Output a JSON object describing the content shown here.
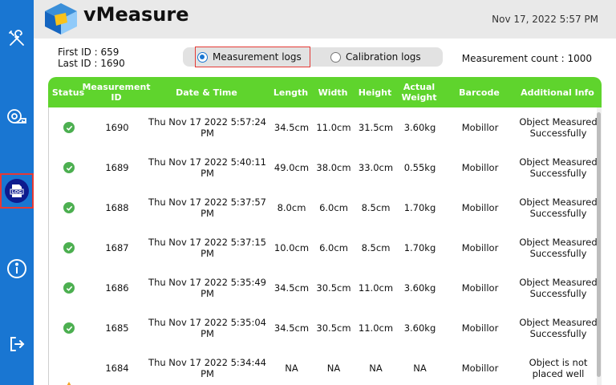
{
  "app": {
    "title": "vMeasure",
    "datetime": "Nov 17, 2022 5:57 PM"
  },
  "sidebar": {
    "items": [
      {
        "name": "tools",
        "icon": "tools-icon"
      },
      {
        "name": "measure",
        "icon": "tape-measure-icon"
      },
      {
        "name": "logs",
        "icon": "log-icon",
        "label": "LOG",
        "active": true
      },
      {
        "name": "info",
        "icon": "info-icon"
      },
      {
        "name": "logout",
        "icon": "logout-icon"
      }
    ]
  },
  "summary": {
    "first_id": "First ID : 659",
    "last_id": "Last ID : 1690",
    "count": "Measurement count : 1000"
  },
  "tabs": {
    "measurement": "Measurement logs",
    "calibration": "Calibration logs",
    "selected": "measurement"
  },
  "table": {
    "headers": [
      "Status",
      "Measurement ID",
      "Date & Time",
      "Length",
      "Width",
      "Height",
      "Actual Weight",
      "Barcode",
      "Additional Info"
    ],
    "rows": [
      {
        "status": "ok",
        "id": "1690",
        "datetime": "Thu Nov 17 2022 5:57:24 PM",
        "length": "34.5cm",
        "width": "11.0cm",
        "height": "31.5cm",
        "weight": "3.60kg",
        "barcode": "Mobillor",
        "info": "Object Measured Successfully"
      },
      {
        "status": "ok",
        "id": "1689",
        "datetime": "Thu Nov 17 2022 5:40:11 PM",
        "length": "49.0cm",
        "width": "38.0cm",
        "height": "33.0cm",
        "weight": "0.55kg",
        "barcode": "Mobillor",
        "info": "Object Measured Successfully"
      },
      {
        "status": "ok",
        "id": "1688",
        "datetime": "Thu Nov 17 2022 5:37:57 PM",
        "length": "8.0cm",
        "width": "6.0cm",
        "height": "8.5cm",
        "weight": "1.70kg",
        "barcode": "Mobillor",
        "info": "Object Measured Successfully"
      },
      {
        "status": "ok",
        "id": "1687",
        "datetime": "Thu Nov 17 2022 5:37:15 PM",
        "length": "10.0cm",
        "width": "6.0cm",
        "height": "8.5cm",
        "weight": "1.70kg",
        "barcode": "Mobillor",
        "info": "Object Measured Successfully"
      },
      {
        "status": "ok",
        "id": "1686",
        "datetime": "Thu Nov 17 2022 5:35:49 PM",
        "length": "34.5cm",
        "width": "30.5cm",
        "height": "11.0cm",
        "weight": "3.60kg",
        "barcode": "Mobillor",
        "info": "Object Measured Successfully"
      },
      {
        "status": "ok",
        "id": "1685",
        "datetime": "Thu Nov 17 2022 5:35:04 PM",
        "length": "34.5cm",
        "width": "30.5cm",
        "height": "11.0cm",
        "weight": "3.60kg",
        "barcode": "Mobillor",
        "info": "Object Measured Successfully"
      },
      {
        "status": "warn",
        "id": "1684",
        "datetime": "Thu Nov 17 2022 5:34:44 PM",
        "length": "NA",
        "width": "NA",
        "height": "NA",
        "weight": "NA",
        "barcode": "Mobillor",
        "info": "Object is not placed well"
      }
    ]
  },
  "colors": {
    "sidebar": "#1976d2",
    "table_header": "#5fd42d",
    "ok": "#4caf50",
    "warn": "#f5a623",
    "highlight": "#e53935"
  }
}
